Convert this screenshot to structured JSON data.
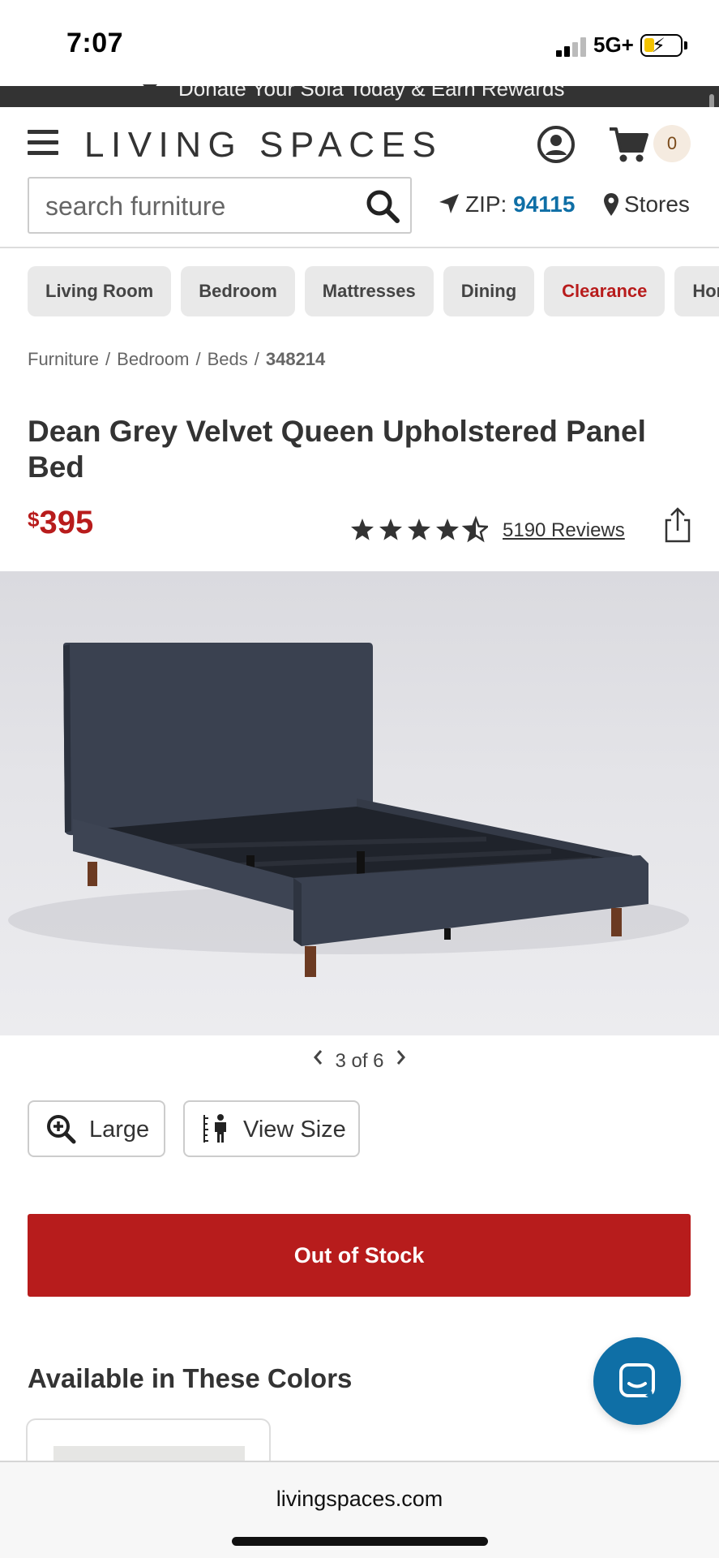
{
  "status_bar": {
    "time": "7:07",
    "network": "5G+"
  },
  "promo": {
    "text": "Donate Your Sofa Today & Earn Rewards"
  },
  "header": {
    "logo": "LIVING SPACES",
    "cart_count": "0",
    "search_placeholder": "search furniture",
    "zip_label": "ZIP:",
    "zip_code": "94115",
    "stores_label": "Stores"
  },
  "categories": [
    "Living Room",
    "Bedroom",
    "Mattresses",
    "Dining",
    "Clearance",
    "Home Decor"
  ],
  "breadcrumb": [
    "Furniture",
    "Bedroom",
    "Beds",
    "348214"
  ],
  "product": {
    "title": "Dean Grey Velvet Queen Upholstered Panel Bed",
    "currency": "$",
    "price": "395",
    "rating": 4.5,
    "reviews": "5190 Reviews",
    "image_index": "3 of 6"
  },
  "actions": {
    "large_label": "Large",
    "view_size_label": "View Size",
    "out_of_stock_label": "Out of Stock"
  },
  "colors_section": {
    "title": "Available in These Colors"
  },
  "browser": {
    "url": "livingspaces.com"
  },
  "colors": {
    "brand_red": "#b71c1c",
    "link_blue": "#0f6fa6",
    "chip_bg": "#e9e9e9"
  }
}
